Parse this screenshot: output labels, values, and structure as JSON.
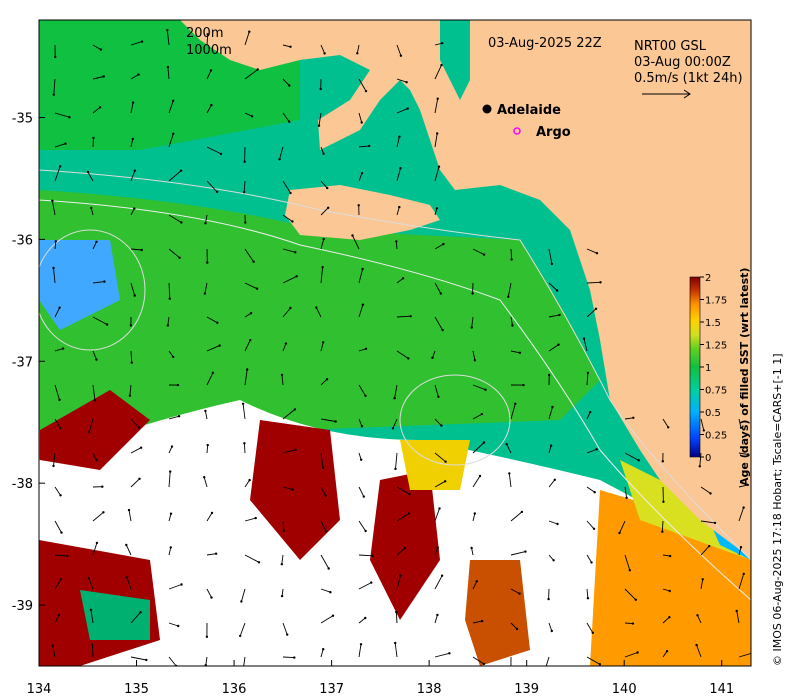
{
  "map": {
    "date_label": "03-Aug-2025 22Z",
    "product": {
      "line1": "NRT00 GSL",
      "line2": "03-Aug 00:00Z",
      "line3": "0.5m/s (1kt 24h)"
    },
    "isobath_legend": [
      "200m",
      "1000m"
    ],
    "places": [
      {
        "name": "Adelaide",
        "lon": 138.6,
        "lat": -34.93
      },
      {
        "name": "Argo",
        "lon": 138.7,
        "lat": -35.1
      }
    ],
    "x_ticks": [
      "134",
      "135",
      "136",
      "137",
      "138",
      "139",
      "140",
      "141"
    ],
    "y_ticks": [
      "-35",
      "-36",
      "-37",
      "-38",
      "-39"
    ],
    "lon_range": [
      134,
      141.3
    ],
    "lat_range": [
      -39.5,
      -34.2
    ],
    "colors": {
      "land": "#fbc795",
      "missing": "#ffffff"
    }
  },
  "colorbar": {
    "title": "Age (days) of filled SST (wrt latest)",
    "ticks": [
      "0",
      "0.25",
      "0.5",
      "0.75",
      "1",
      "1.25",
      "1.5",
      "1.75",
      "2"
    ],
    "range": [
      0,
      2
    ],
    "colors": [
      "#00007f",
      "#0040ff",
      "#00b0ff",
      "#00d0a0",
      "#00c070",
      "#40d020",
      "#c0e020",
      "#ffd000",
      "#ff9000",
      "#c03000",
      "#800000"
    ]
  },
  "credit": "© IMOS 06-Aug-2025 17:18 Hobart; Tscale=CARS+[-1 1]"
}
